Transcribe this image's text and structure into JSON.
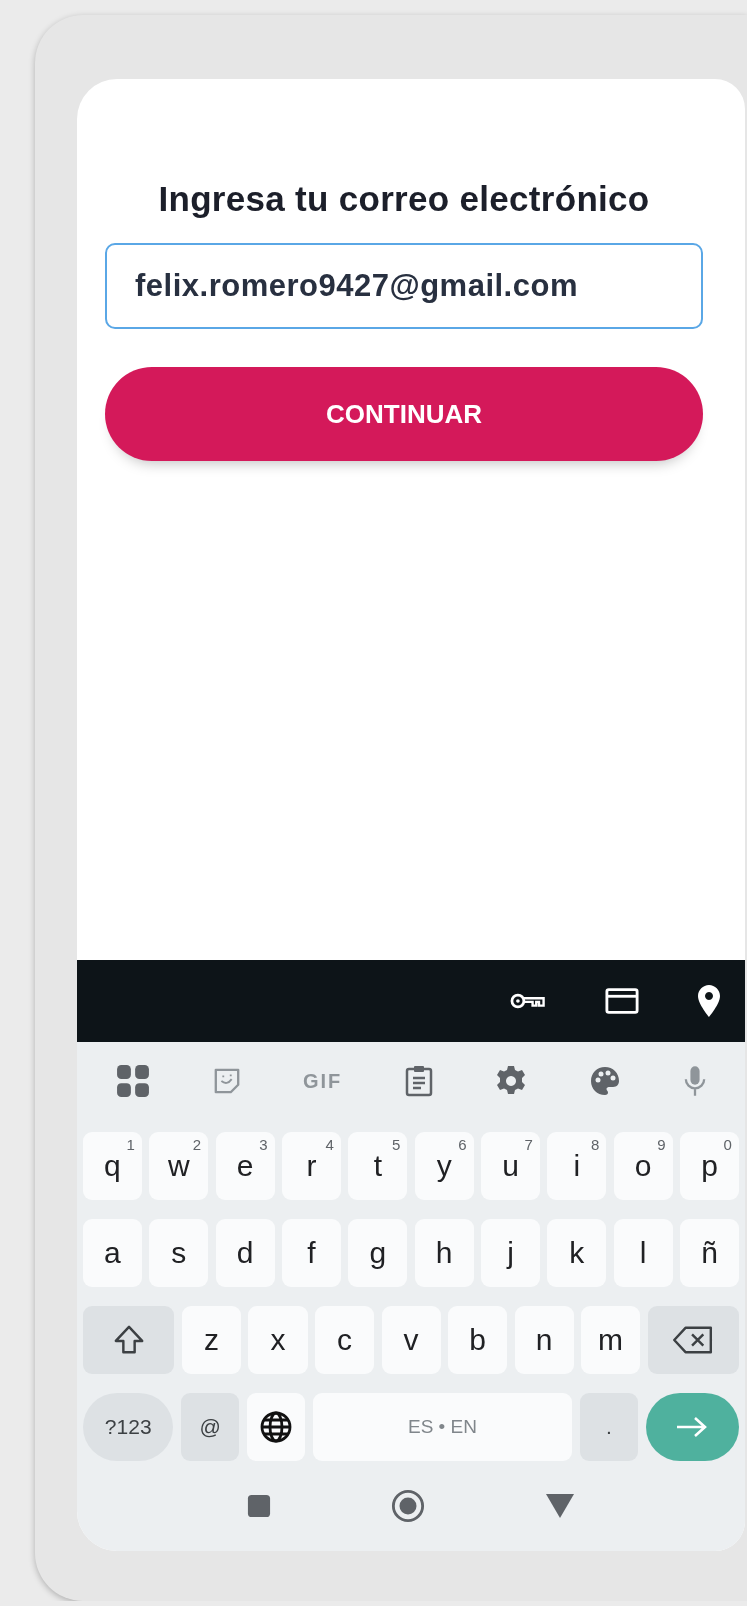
{
  "form": {
    "heading": "Ingresa tu correo electrónico",
    "email_field": {
      "value": "felix.romero9427@gmail.com",
      "focused": true
    },
    "continue_button": {
      "label": "CONTINUAR"
    }
  },
  "keyboard": {
    "toolbar": [
      {
        "kind": "apps",
        "disabled": false
      },
      {
        "kind": "sticker",
        "disabled": true
      },
      {
        "kind": "gif",
        "label": "GIF",
        "disabled": true
      },
      {
        "kind": "clipboard",
        "disabled": false
      },
      {
        "kind": "settings",
        "disabled": false
      },
      {
        "kind": "palette",
        "disabled": false
      },
      {
        "kind": "mic",
        "disabled": true
      }
    ],
    "rows": [
      {
        "keys": [
          {
            "kind": "letter",
            "label": "q",
            "hint": "1"
          },
          {
            "kind": "letter",
            "label": "w",
            "hint": "2"
          },
          {
            "kind": "letter",
            "label": "e",
            "hint": "3"
          },
          {
            "kind": "letter",
            "label": "r",
            "hint": "4"
          },
          {
            "kind": "letter",
            "label": "t",
            "hint": "5"
          },
          {
            "kind": "letter",
            "label": "y",
            "hint": "6"
          },
          {
            "kind": "letter",
            "label": "u",
            "hint": "7"
          },
          {
            "kind": "letter",
            "label": "i",
            "hint": "8"
          },
          {
            "kind": "letter",
            "label": "o",
            "hint": "9"
          },
          {
            "kind": "letter",
            "label": "p",
            "hint": "0"
          }
        ]
      },
      {
        "keys": [
          {
            "kind": "letter",
            "label": "a"
          },
          {
            "kind": "letter",
            "label": "s"
          },
          {
            "kind": "letter",
            "label": "d"
          },
          {
            "kind": "letter",
            "label": "f"
          },
          {
            "kind": "letter",
            "label": "g"
          },
          {
            "kind": "letter",
            "label": "h"
          },
          {
            "kind": "letter",
            "label": "j"
          },
          {
            "kind": "letter",
            "label": "k"
          },
          {
            "kind": "letter",
            "label": "l"
          },
          {
            "kind": "letter",
            "label": "ñ"
          }
        ]
      },
      {
        "keys": [
          {
            "kind": "shift"
          },
          {
            "kind": "letter",
            "label": "z"
          },
          {
            "kind": "letter",
            "label": "x"
          },
          {
            "kind": "letter",
            "label": "c"
          },
          {
            "kind": "letter",
            "label": "v"
          },
          {
            "kind": "letter",
            "label": "b"
          },
          {
            "kind": "letter",
            "label": "n"
          },
          {
            "kind": "letter",
            "label": "m"
          },
          {
            "kind": "backspace"
          }
        ]
      },
      {
        "keys": [
          {
            "kind": "symbols",
            "label": "?123"
          },
          {
            "kind": "char",
            "label": "@"
          },
          {
            "kind": "globe"
          },
          {
            "kind": "space",
            "label": "ES • EN"
          },
          {
            "kind": "char",
            "label": "."
          },
          {
            "kind": "enter"
          }
        ]
      }
    ]
  }
}
